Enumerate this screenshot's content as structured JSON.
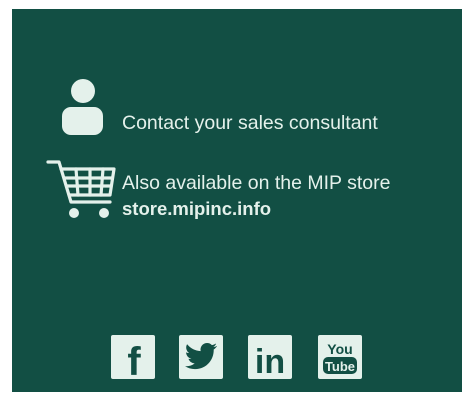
{
  "contact": {
    "text": "Contact your sales consultant",
    "icon": "person-icon"
  },
  "store": {
    "line1": "Also available on the MIP store",
    "link": "store.mipinc.info",
    "icon": "shopping-cart-icon"
  },
  "social": [
    {
      "icon": "facebook-icon",
      "glyph": "f"
    },
    {
      "icon": "twitter-icon"
    },
    {
      "icon": "linkedin-icon",
      "glyph": "in"
    },
    {
      "icon": "youtube-icon",
      "glyph_top": "You",
      "glyph_bottom": "Tube"
    }
  ],
  "colors": {
    "background": "#124f44",
    "foreground": "#e4f1eb",
    "page": "#ffffff"
  }
}
